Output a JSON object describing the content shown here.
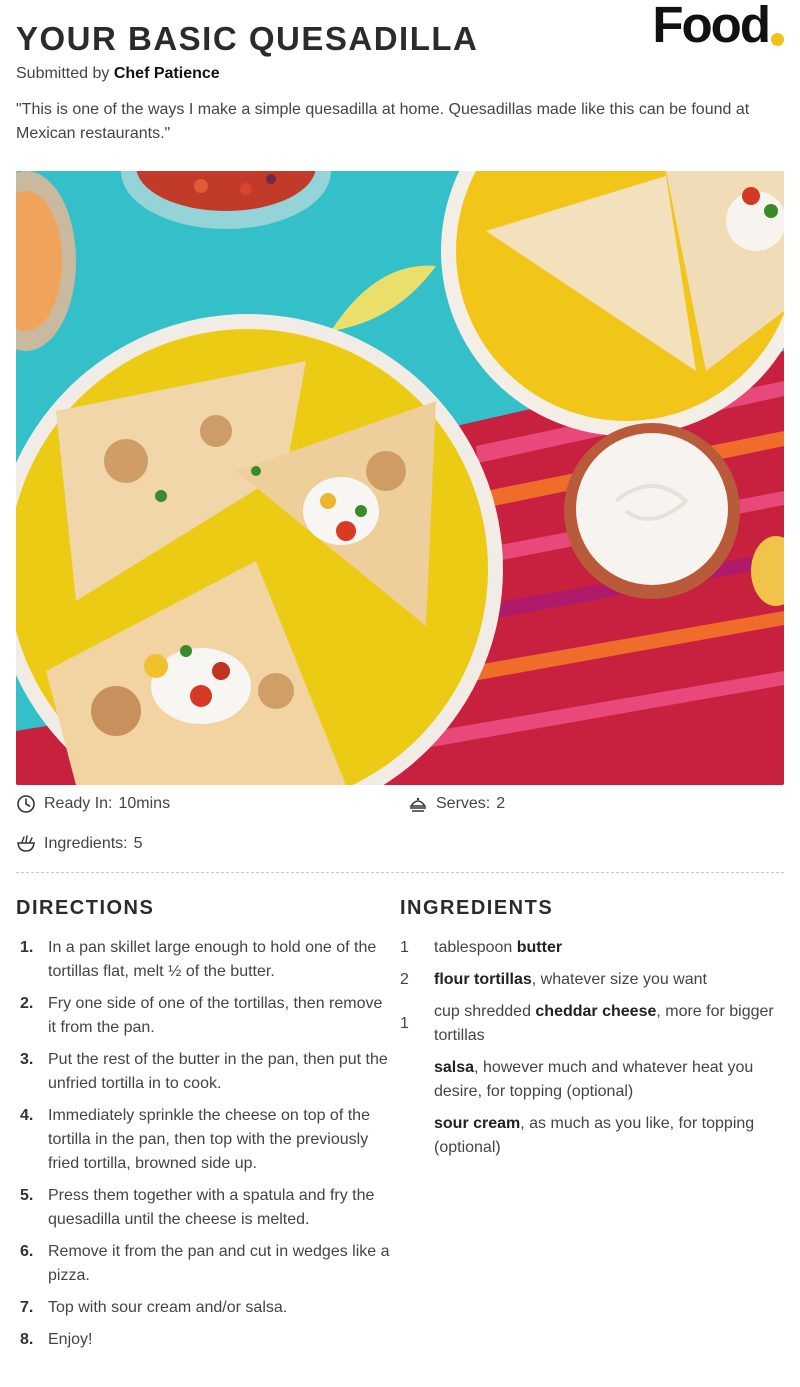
{
  "title": "YOUR BASIC QUESADILLA",
  "brand": {
    "logo_text": "Food",
    "dot_color": "#f2c21b"
  },
  "submitted": {
    "prefix": "Submitted by",
    "author": "Chef Patience"
  },
  "description": "\"This is one of the ways I make a simple quesadilla at home. Quesadillas made like this can be found at Mexican restaurants.\"",
  "photo": {
    "icon": "quesadilla-photo"
  },
  "meta": {
    "ready_in": {
      "label": "Ready In:",
      "value": "10mins",
      "icon": "clock-icon"
    },
    "serves": {
      "label": "Serves:",
      "value": "2",
      "icon": "serving-dish-icon"
    },
    "ingredients_count": {
      "label": "Ingredients:",
      "value": "5",
      "icon": "bowl-icon"
    }
  },
  "directions": {
    "heading": "DIRECTIONS",
    "steps": [
      {
        "num": "1.",
        "text": "In a pan skillet large enough to hold one of the tortillas flat, melt ½ of the butter."
      },
      {
        "num": "2.",
        "text": "Fry one side of one of the tortillas, then remove it from the pan."
      },
      {
        "num": "3.",
        "text": "Put the rest of the butter in the pan, then put the unfried tortilla in to cook."
      },
      {
        "num": "4.",
        "text": "Immediately sprinkle the cheese on top of the tortilla in the pan, then top with the previously fried tortilla, browned side up."
      },
      {
        "num": "5.",
        "text": "Press them together with a spatula and fry the quesadilla until the cheese is melted."
      },
      {
        "num": "6.",
        "text": "Remove it from the pan and cut in wedges like a pizza."
      },
      {
        "num": "7.",
        "text": "Top with sour cream and/or salsa."
      },
      {
        "num": "8.",
        "text": "Enjoy!"
      }
    ]
  },
  "ingredients": {
    "heading": "INGREDIENTS",
    "items": [
      {
        "qty": "1",
        "pre": "tablespoon ",
        "bold": "butter",
        "post": ""
      },
      {
        "qty": "2",
        "pre": "",
        "bold": "flour tortillas",
        "post": ", whatever size you want"
      },
      {
        "qty": "1",
        "pre": "cup shredded ",
        "bold": "cheddar cheese",
        "post": ", more for bigger tortillas"
      },
      {
        "qty": "",
        "pre": "",
        "bold": "salsa",
        "post": ", however much and whatever heat you desire, for topping (optional)"
      },
      {
        "qty": "",
        "pre": "",
        "bold": "sour cream",
        "post": ", as much as you like, for topping (optional)"
      }
    ]
  }
}
